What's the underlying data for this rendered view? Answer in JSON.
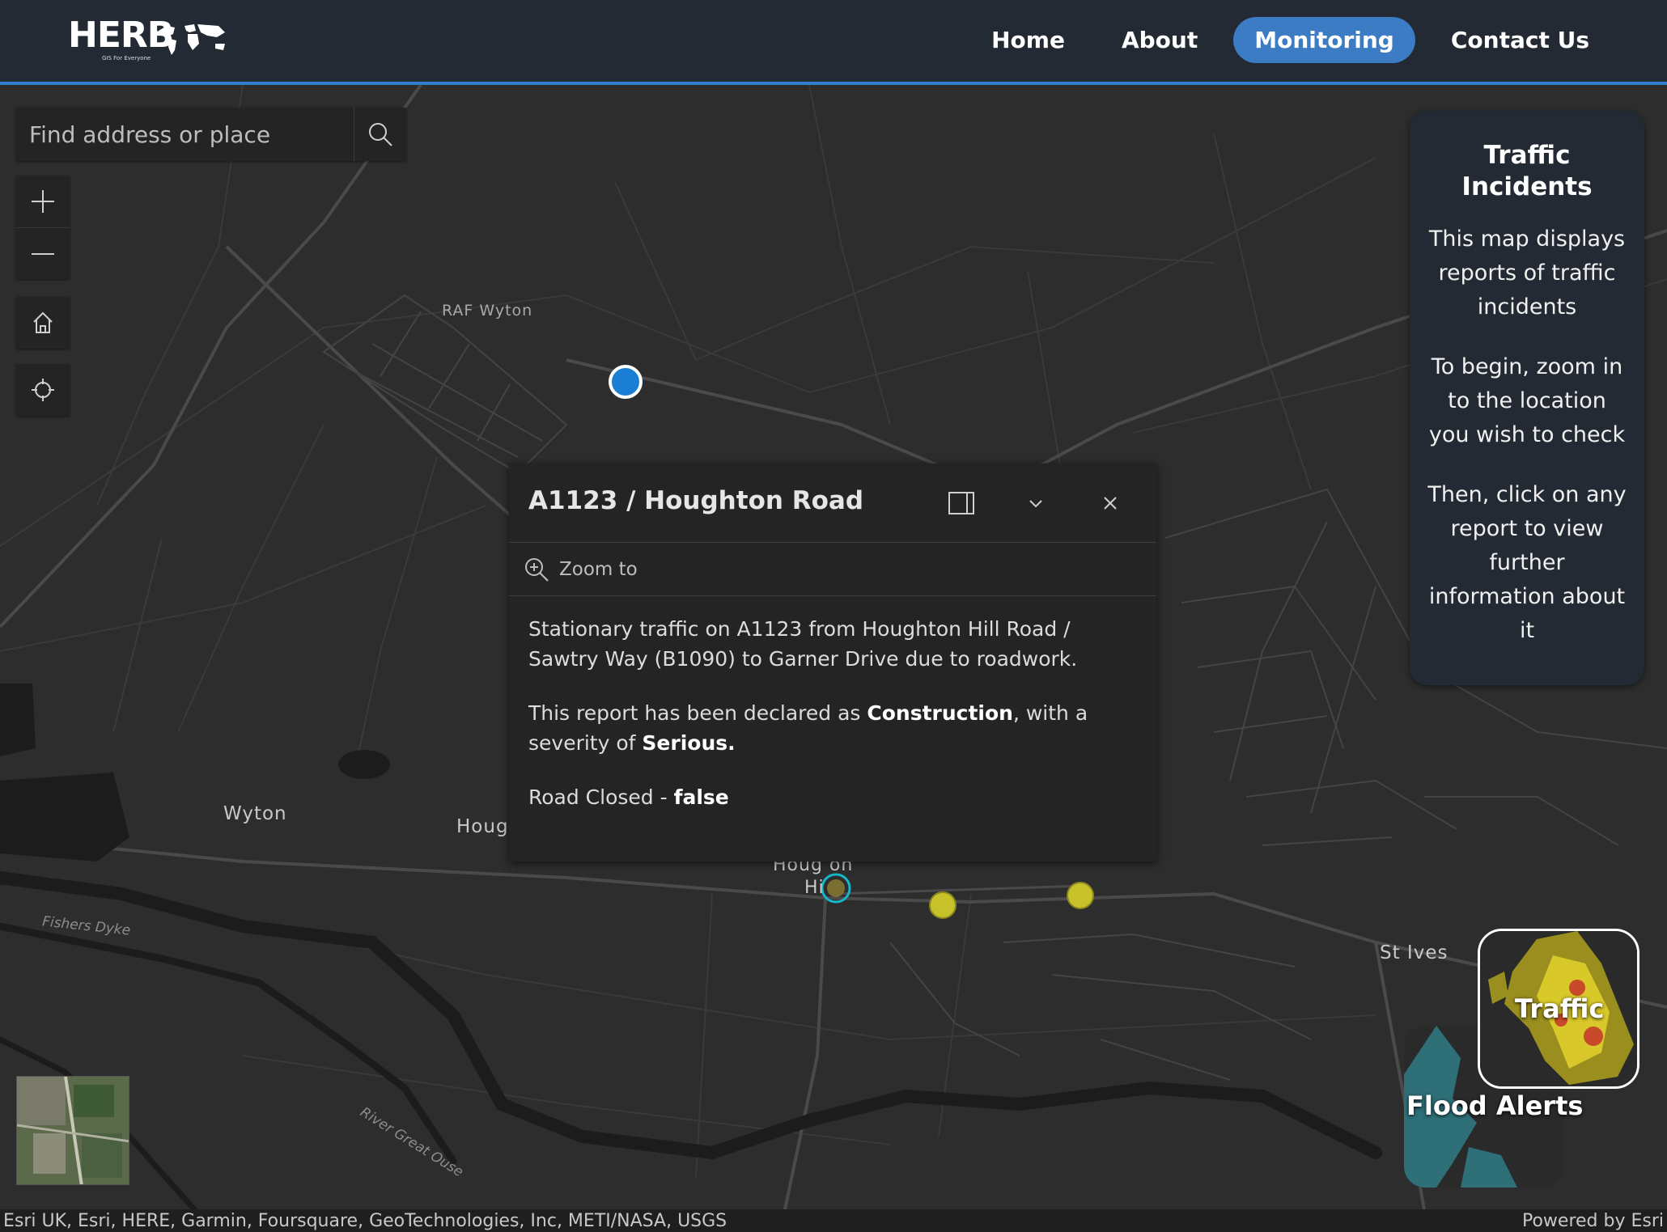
{
  "header": {
    "logo": {
      "name": "HERB",
      "tagline": "GIS For Everyone"
    },
    "nav": [
      {
        "label": "Home",
        "active": false
      },
      {
        "label": "About",
        "active": false
      },
      {
        "label": "Monitoring",
        "active": true
      },
      {
        "label": "Contact Us",
        "active": false
      }
    ]
  },
  "search": {
    "placeholder": "Find address or place"
  },
  "map_labels": {
    "raf_wyton": "RAF Wyton",
    "wyton": "Wyton",
    "houghton_partial": "Hougl",
    "houghton_hill_line1": "Houg  on",
    "houghton_hill_line2": "Hi",
    "st_ives": "St Ives",
    "fishers_dyke": "Fishers Dyke",
    "river": "River Great Ouse"
  },
  "popup": {
    "title": "A1123 / Houghton Road",
    "zoom_to": "Zoom to",
    "description": "Stationary traffic on A1123 from Houghton Hill Road / Sawtry Way (B1090) to Garner Drive due to roadwork.",
    "declared_prefix": "This report has been declared as ",
    "type": "Construction",
    "severity_prefix": ", with a severity of ",
    "severity": "Serious.",
    "road_closed_label": "Road Closed - ",
    "road_closed_value": "false"
  },
  "info_panel": {
    "title": "Traffic Incidents",
    "paragraphs": [
      "This map displays reports of traffic incidents",
      "To begin, zoom in to the location you wish to check",
      "Then, click on any report to view further information about it"
    ]
  },
  "layers": {
    "flood_label": "Flood Alerts",
    "traffic_label": "Traffic"
  },
  "attribution": {
    "left": "Esri UK, Esri, HERE, Garmin, Foursquare, GeoTechnologies, Inc, METI/NASA, USGS",
    "right": "Powered by Esri"
  },
  "colors": {
    "header_bg": "#232a33",
    "accent": "#3b7cc4",
    "incident_marker": "#c8c22a",
    "location_marker": "#1a7fd4"
  }
}
